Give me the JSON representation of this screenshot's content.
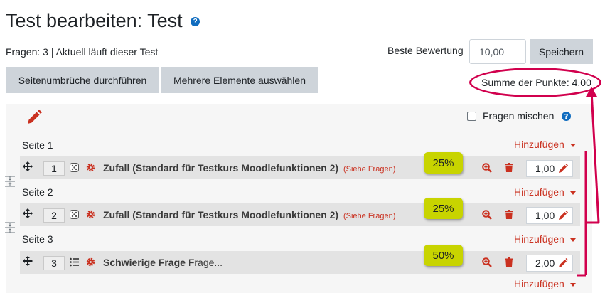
{
  "page": {
    "title": "Test bearbeiten: Test",
    "help_icon": "question-circle-icon",
    "status": "Fragen: 3 | Aktuell läuft dieser Test"
  },
  "grading": {
    "best_label": "Beste Bewertung",
    "best_value": "10,00",
    "save_label": "Speichern",
    "sum_text": "Summe der Punkte: 4,00"
  },
  "toolbar": {
    "repaginate_label": "Seitenumbrüche durchführen",
    "select_multiple_label": "Mehrere Elemente auswählen"
  },
  "shuffle": {
    "label": "Fragen mischen",
    "checked": false
  },
  "add_label": "Hinzufügen",
  "sections": [
    {
      "page_label": "Seite 1",
      "slot": "1",
      "qtype_icon": "dice-icon",
      "name": "Zufall (Standard für Testkurs Moodlefunktionen 2)",
      "qtext": "",
      "preview_link": "(Siehe Fragen)",
      "mark": "1,00",
      "badge": "25%"
    },
    {
      "page_label": "Seite 2",
      "slot": "2",
      "qtype_icon": "dice-icon",
      "name": "Zufall (Standard für Testkurs Moodlefunktionen 2)",
      "qtext": "",
      "preview_link": "(Siehe Fragen)",
      "mark": "1,00",
      "badge": "25%"
    },
    {
      "page_label": "Seite 3",
      "slot": "3",
      "qtype_icon": "list-icon",
      "name": "Schwierige Frage",
      "qtext": "Frage...",
      "preview_link": "",
      "mark": "2,00",
      "badge": "50%"
    }
  ],
  "colors": {
    "annotation": "#d1004d",
    "badge": "#c8d400",
    "accent_red": "#ca3120",
    "help_blue": "#0f6cbf"
  }
}
